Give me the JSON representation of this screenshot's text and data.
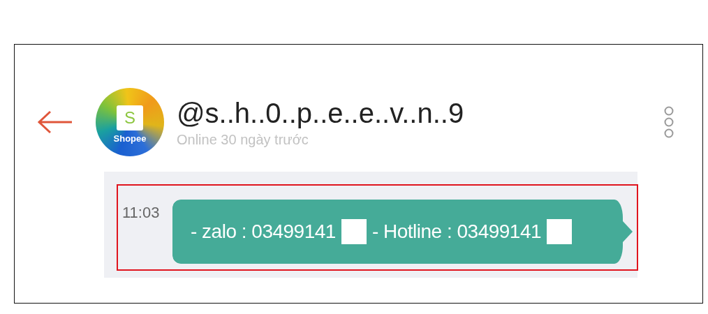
{
  "header": {
    "avatar": {
      "letter": "S",
      "brand": "Shopee"
    },
    "name": "@s..h..0..p..e..e..v..n..9",
    "status": "Online 30 ngày trước"
  },
  "message": {
    "time": "11:03",
    "highlighted": true,
    "parts": [
      {
        "kind": "text",
        "text": "- zalo : 03499141"
      },
      {
        "kind": "redaction"
      },
      {
        "kind": "text",
        "text": "- Hotline : 03499141"
      },
      {
        "kind": "redaction"
      }
    ]
  }
}
